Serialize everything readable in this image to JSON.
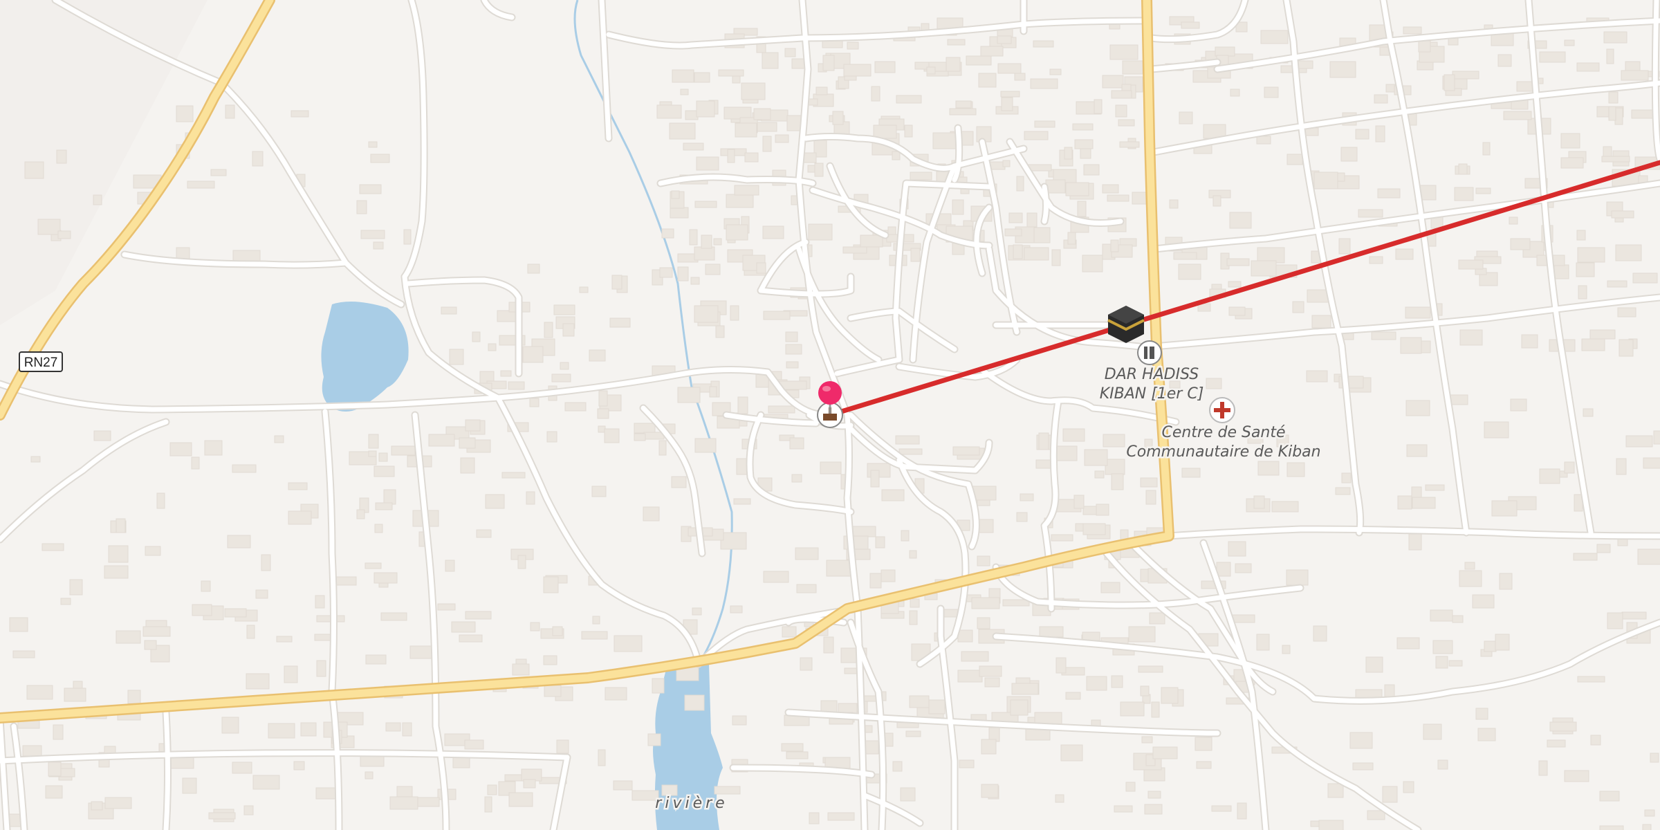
{
  "map": {
    "colors": {
      "background": "#f5f3f0",
      "road": "#ffffff",
      "road_casing": "#dedad4",
      "primary_road": "#fbe29b",
      "primary_casing": "#e9c06f",
      "water": "#a9cde6",
      "building": "#ebe6df",
      "route_line": "#d72b2b",
      "pin": "#ef2a6a"
    },
    "road_shield": "RN27",
    "labels": {
      "poi_1": [
        "DAR HADISS",
        "KIBAN [1er C]"
      ],
      "poi_2": [
        "Centre de Santé",
        "Communautaire de Kiban"
      ],
      "water": "rivière"
    },
    "icons": {
      "pin": "location-pin-icon",
      "mosque": "mosque-icon",
      "kaaba": "kaaba-icon",
      "school": "school-icon",
      "health": "health-cross-icon"
    }
  }
}
